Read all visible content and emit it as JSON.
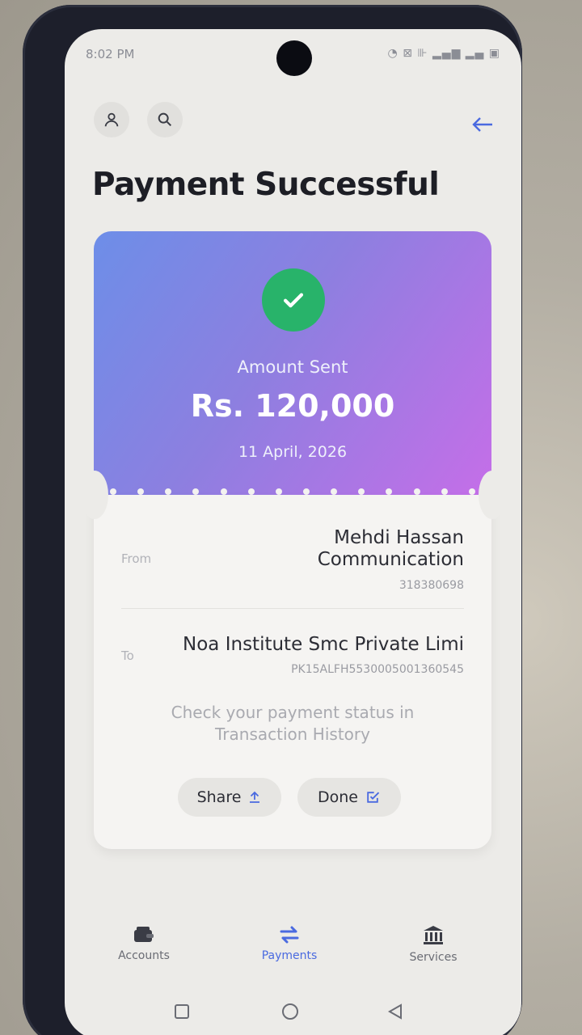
{
  "status_bar": {
    "time": "8:02 PM",
    "icons": "◔ ⊠ ⊪ ▂▄▆ ▂▄ ▣"
  },
  "header": {
    "profile_icon": "person-icon",
    "search_icon": "search-icon",
    "back_icon": "arrow-left-icon",
    "title": "Payment Successful"
  },
  "receipt": {
    "success_icon": "check-icon",
    "amount_label": "Amount Sent",
    "amount": "Rs. 120,000",
    "date": "11 April, 2026",
    "from_label": "From",
    "from_name": "Mehdi Hassan Communication",
    "from_account": "318380698",
    "to_label": "To",
    "to_name": "Noa Institute Smc Private Limi",
    "to_account": "PK15ALFH5530005001360545",
    "status_note_line1": "Check your payment status in",
    "status_note_line2": "Transaction History",
    "share_label": "Share",
    "done_label": "Done"
  },
  "bottom_nav": {
    "items": [
      {
        "label": "Accounts",
        "icon": "wallet-icon"
      },
      {
        "label": "Payments",
        "icon": "transfer-icon"
      },
      {
        "label": "Services",
        "icon": "bank-icon"
      }
    ]
  },
  "colors": {
    "accent": "#4a6ae0",
    "success": "#28b36a",
    "gradient_start": "#6d8ee8",
    "gradient_end": "#c56ee8"
  }
}
